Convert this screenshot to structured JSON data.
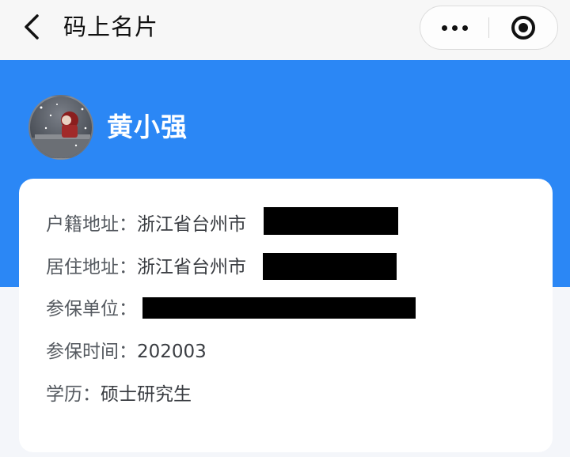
{
  "topbar": {
    "title": "码上名片",
    "back_icon": "chevron-left-icon",
    "more_icon": "more-dots-icon",
    "close_icon": "mini-program-close-icon"
  },
  "profile": {
    "name": "黄小强",
    "banner_color": "#2b87f5"
  },
  "info": {
    "huji_label": "户籍地址：",
    "huji_value": "浙江省台州市",
    "juzhu_label": "居住地址：",
    "juzhu_value": "浙江省台州市",
    "canbao_unit_label": "参保单位：",
    "canbao_time_label": "参保时间：",
    "canbao_time_value": "202003",
    "xueli_label": "学历：",
    "xueli_value": "硕士研究生"
  }
}
